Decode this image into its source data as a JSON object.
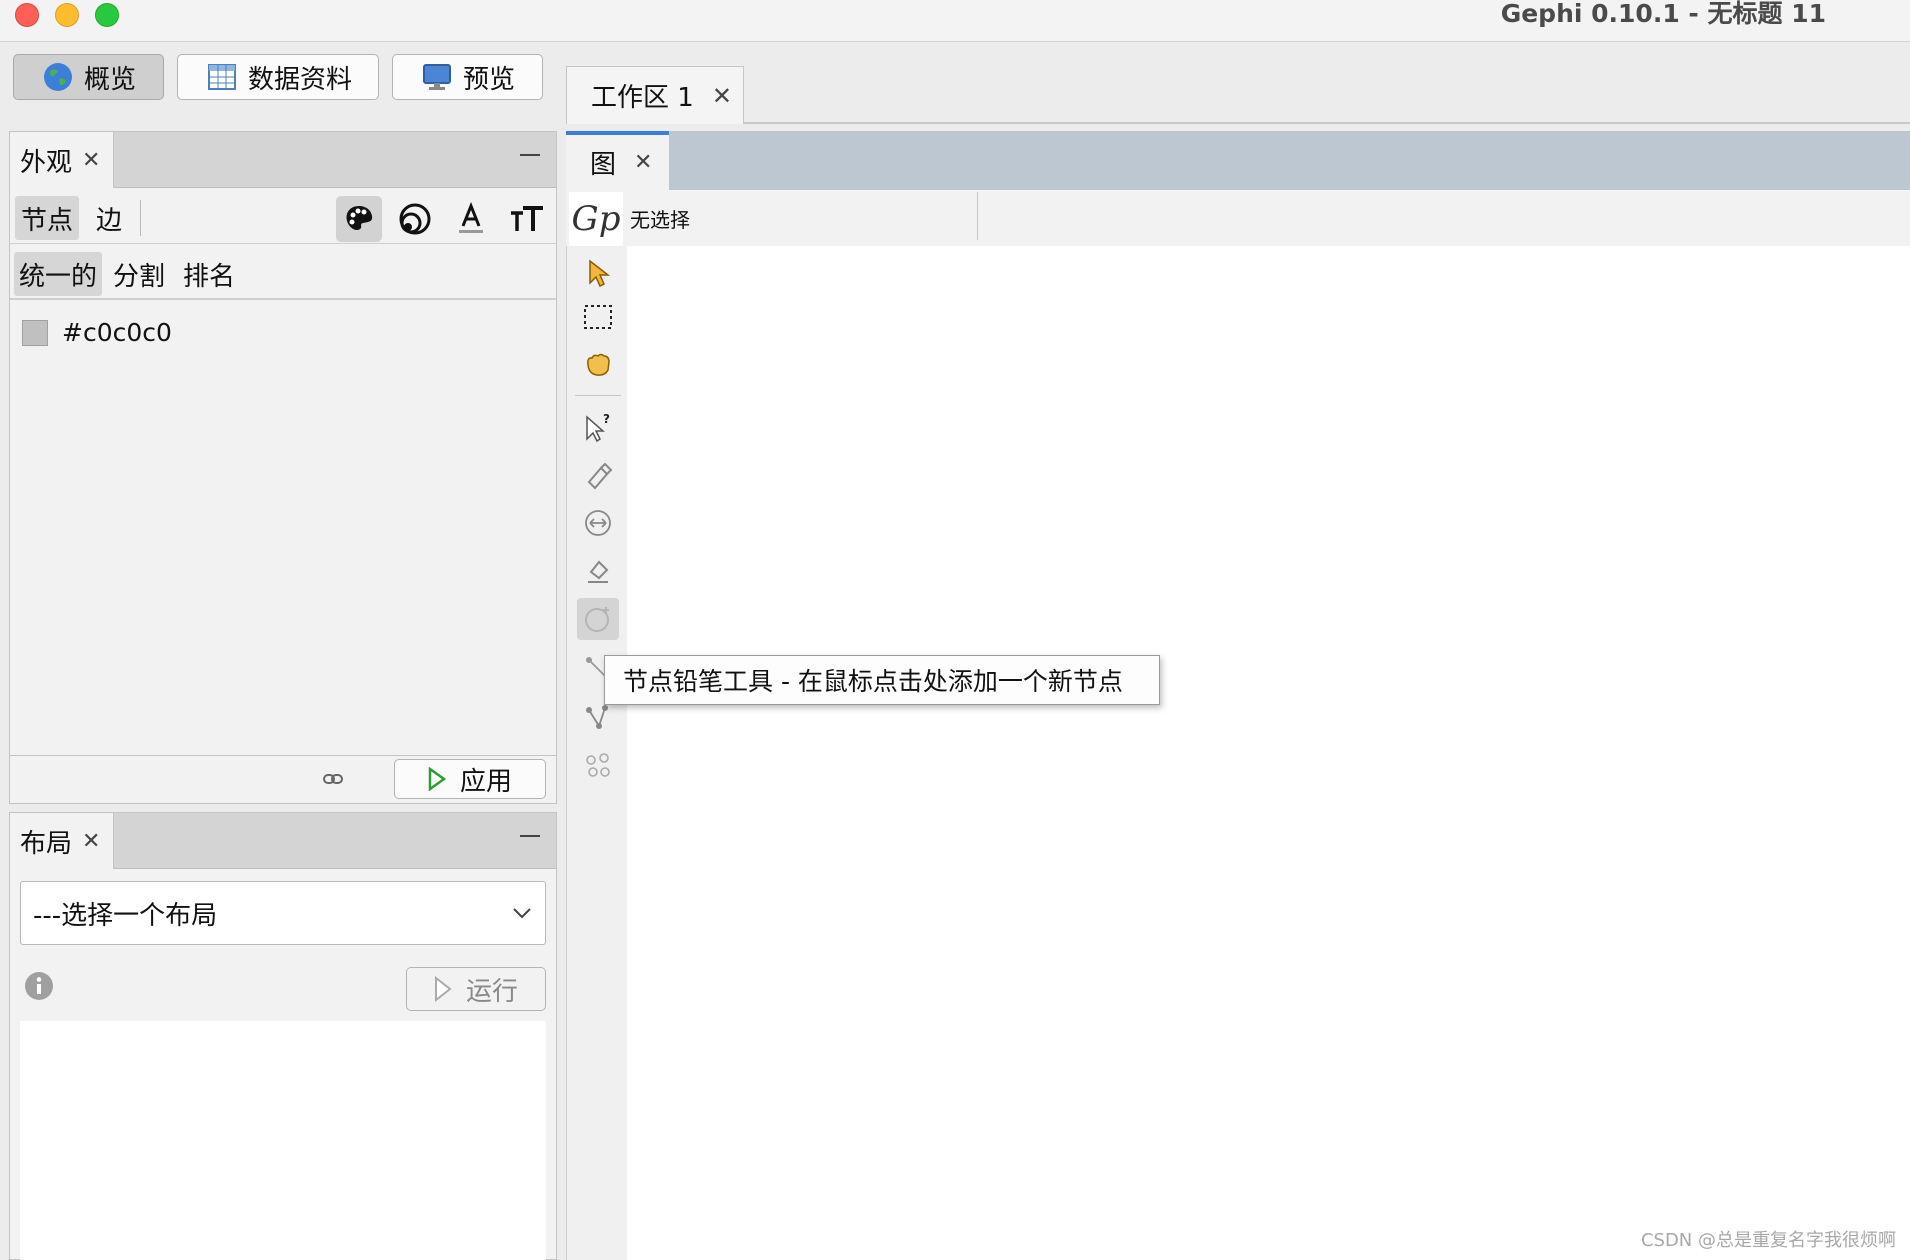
{
  "window": {
    "title": "Gephi 0.10.1 - 无标题 11"
  },
  "modes": [
    {
      "label": "概览",
      "icon": "globe-icon",
      "active": true
    },
    {
      "label": "数据资料",
      "icon": "table-icon",
      "active": false
    },
    {
      "label": "预览",
      "icon": "monitor-icon",
      "active": false
    }
  ],
  "workspace_tab": {
    "label": "工作区 1"
  },
  "appearance": {
    "title": "外观",
    "element_tabs": [
      "节点",
      "边"
    ],
    "mode_tabs": [
      "统一的",
      "分割",
      "排名"
    ],
    "color_value": "#c0c0c0",
    "apply_label": "应用",
    "tools": [
      "palette-icon",
      "size-icon",
      "label-color-icon",
      "label-size-icon"
    ]
  },
  "layout": {
    "title": "布局",
    "select_placeholder": "---选择一个布局",
    "run_label": "运行"
  },
  "graph": {
    "tab_label": "图",
    "logo_text": "Gp",
    "selection_status": "无选择",
    "tooltip": "节点铅笔工具 - 在鼠标点击处添加一个新节点"
  },
  "watermark": "CSDN @总是重复名字我很烦啊"
}
